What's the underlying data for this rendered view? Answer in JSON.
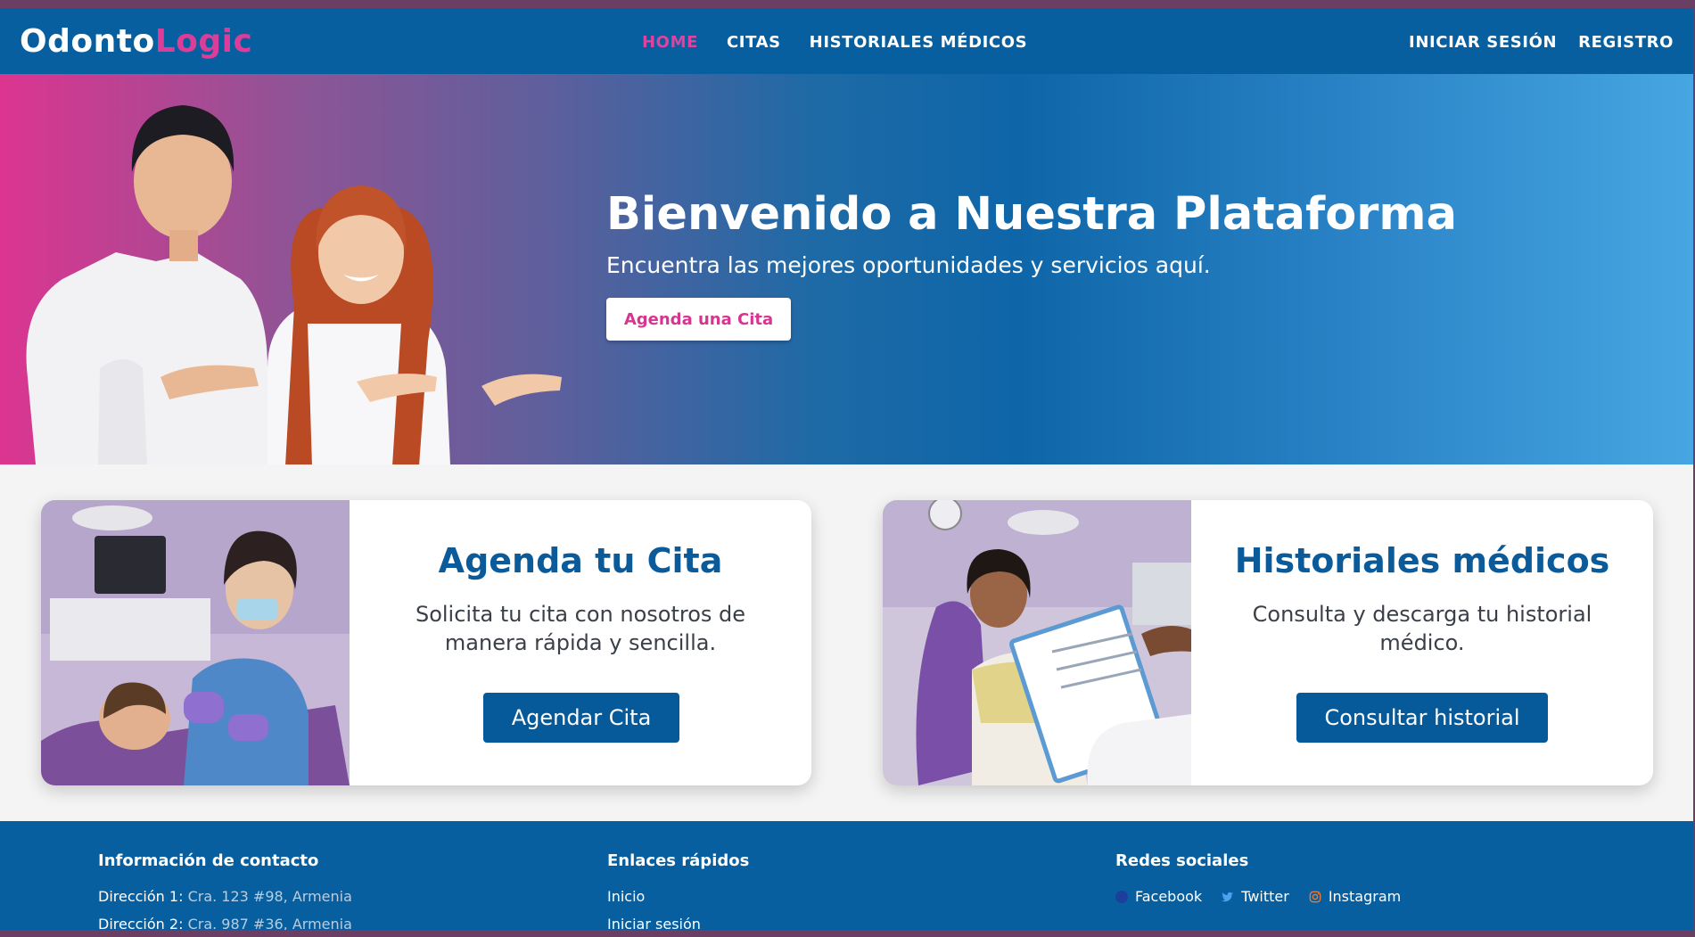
{
  "brand": {
    "part1": "Odonto",
    "part2": "Logic"
  },
  "nav": {
    "center": [
      {
        "label": "HOME",
        "active": true
      },
      {
        "label": "CITAS",
        "active": false
      },
      {
        "label": "HISTORIALES MÉDICOS",
        "active": false
      }
    ],
    "right": [
      {
        "label": "INICIAR SESIÓN"
      },
      {
        "label": "REGISTRO"
      }
    ]
  },
  "hero": {
    "title": "Bienvenido a Nuestra Plataforma",
    "subtitle": "Encuentra las mejores oportunidades y servicios aquí.",
    "button": "Agenda una Cita"
  },
  "cards": [
    {
      "title": "Agenda tu Cita",
      "text": "Solicita tu cita con nosotros de manera rápida y sencilla.",
      "button": "Agendar Cita"
    },
    {
      "title": "Historiales médicos",
      "text": "Consulta y descarga tu historial médico.",
      "button": "Consultar historial"
    }
  ],
  "footer": {
    "contact": {
      "heading": "Información de contacto",
      "rows": [
        {
          "label": "Dirección 1:",
          "value": "Cra. 123 #98, Armenia"
        },
        {
          "label": "Dirección 2:",
          "value": "Cra. 987 #36, Armenia"
        }
      ]
    },
    "links": {
      "heading": "Enlaces rápidos",
      "items": [
        "Inicio",
        "Iniciar sesión"
      ]
    },
    "social": {
      "heading": "Redes sociales",
      "items": [
        {
          "label": "Facebook",
          "icon": "facebook-icon"
        },
        {
          "label": "Twitter",
          "icon": "twitter-icon"
        },
        {
          "label": "Instagram",
          "icon": "instagram-icon"
        }
      ]
    }
  },
  "colors": {
    "navbar": "#075f9f",
    "accent_pink": "#dc3d98",
    "card_title": "#0b5a99",
    "button_blue": "#065a9a"
  }
}
